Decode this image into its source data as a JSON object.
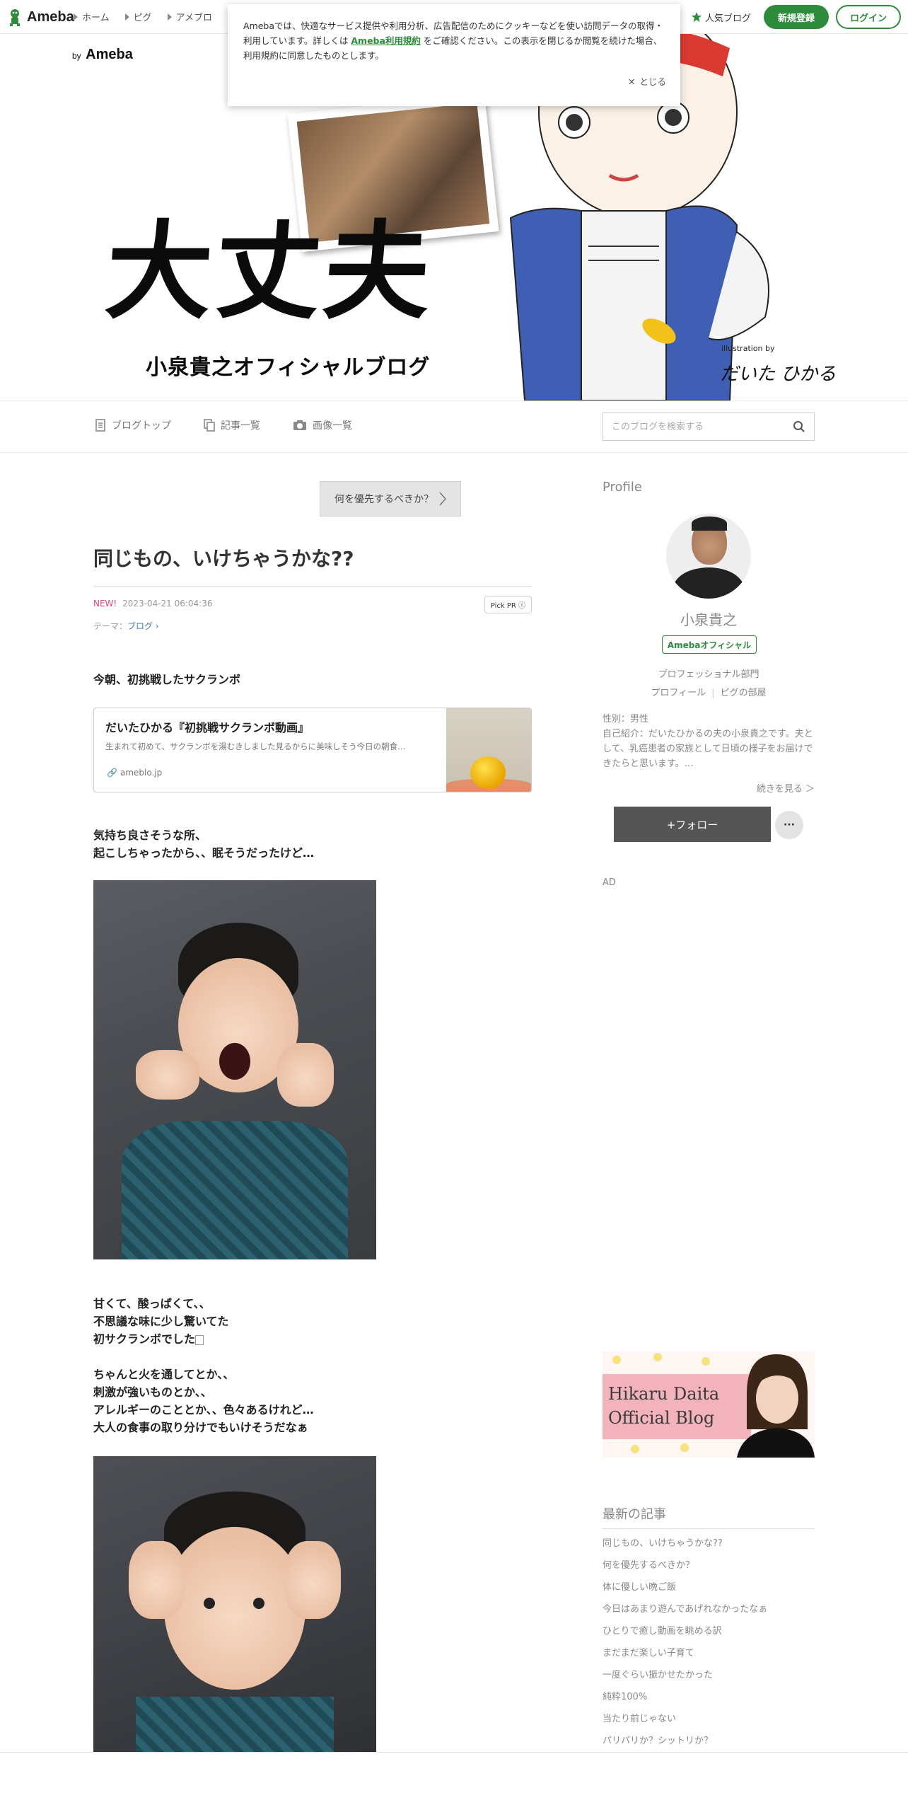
{
  "topbar": {
    "brand": "Ameba",
    "nav": [
      "ホーム",
      "ピグ",
      "アメブロ"
    ],
    "popular": "人気ブログ",
    "signup": "新規登録",
    "login": "ログイン"
  },
  "cookie": {
    "text_before": "Amebaでは、快適なサービス提供や利用分析、広告配信のためにクッキーなどを使い訪問データの取得・利用しています。詳しくは",
    "link": "Ameba利用規約",
    "text_after": "をご確認ください。この表示を閉じるか閲覧を続けた場合、利用規約に同意したものとします。",
    "close": "とじる"
  },
  "banner": {
    "by": "by",
    "ameba": "Ameba",
    "title": "大丈夫",
    "subtitle": "小泉貴之オフィシャルブログ",
    "illus_by": "illustration by",
    "illus_sign": "だいた ひかる"
  },
  "blognav": {
    "items": [
      "ブログトップ",
      "記事一覧",
      "画像一覧"
    ],
    "search_placeholder": "このブログを検索する"
  },
  "post": {
    "prev": "何を優先するべきか？",
    "title": "同じもの、いけちゃうかな??",
    "new": "NEW!",
    "date": "2023-04-21 06:04:36",
    "pickpr": "Pick PR ⓘ",
    "theme_label": "テーマ：",
    "theme": "ブログ",
    "p1": "今朝、初挑戦したサクランボ",
    "card": {
      "title": "だいたひかる『初挑戦サクランボ動画』",
      "desc": "生まれて初めて、サクランボを湯むきしました見るからに美味しそう今日の朝食…",
      "domain": "ameblo.jp"
    },
    "p2_1": "気持ち良さそうな所、",
    "p2_2": "起こしちゃったから、、眠そうだったけど…",
    "p3_1": "甘くて、酸っぱくて、、",
    "p3_2": "不思議な味に少し驚いてた",
    "p3_3": "初サクランボでした",
    "p4_1": "ちゃんと火を通してとか、、",
    "p4_2": "刺激が強いものとか、、",
    "p4_3": "アレルギーのこととか、、色々あるけれど…",
    "p4_4": "大人の食事の取り分けでもいけそうだなぁ"
  },
  "sidebar": {
    "profile_h": "Profile",
    "name": "小泉貴之",
    "official": "Amebaオフィシャル",
    "pro": "プロフェッショナル部門",
    "link_profile": "プロフィール",
    "link_pig": "ピグの部屋",
    "gender": "性別：男性",
    "bio": "自己紹介：だいたひかるの夫の小泉貴之です。夫として、乳癌患者の家族として日頃の様子をお届けできたらと思います。…",
    "more": "続きを見る ＞",
    "follow": "+フォロー",
    "dots": "···",
    "ad": "AD",
    "banner_line1": "Hikaru Daita",
    "banner_line2": "Official Blog",
    "latest_h": "最新の記事",
    "latest": [
      "同じもの、いけちゃうかな??",
      "何を優先するべきか？",
      "体に優しい晩ご飯",
      "今日はあまり遊んであげれなかったなぁ",
      "ひとりで癒し動画を眺める訳",
      "まだまだ楽しい子育て",
      "一度ぐらい振かせたかった",
      "純粋100%",
      "当たり前じゃない",
      "パリパリか？シットリか？"
    ]
  },
  "colors": {
    "accent": "#2d8c3c",
    "new": "#e0457b",
    "link": "#3a7bbf"
  }
}
